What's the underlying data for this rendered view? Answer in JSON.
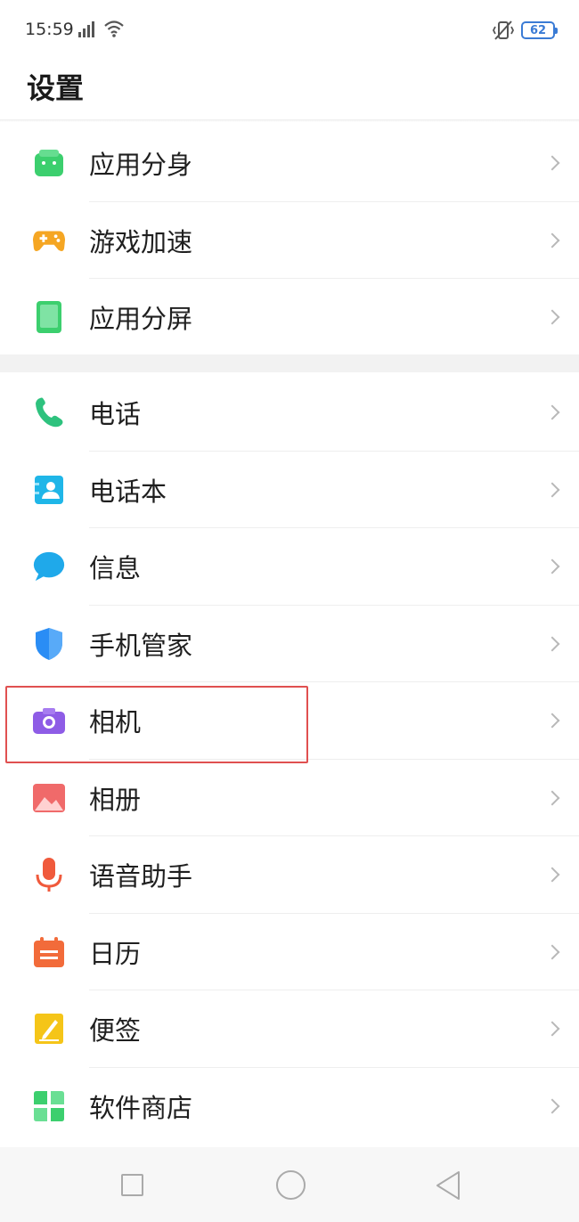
{
  "status_bar": {
    "time": "15:59",
    "battery_level": "62",
    "icons": [
      "signal-icon",
      "wifi-icon",
      "vibrate-icon",
      "battery-icon"
    ]
  },
  "header": {
    "title": "设置"
  },
  "groups": [
    {
      "items": [
        {
          "label": "应用分身",
          "icon": "app-clone-icon",
          "color": "#3ccf6e"
        },
        {
          "label": "游戏加速",
          "icon": "gamepad-icon",
          "color": "#f5a623"
        },
        {
          "label": "应用分屏",
          "icon": "split-screen-icon",
          "color": "#3ccf6e"
        }
      ]
    },
    {
      "items": [
        {
          "label": "电话",
          "icon": "phone-icon",
          "color": "#2ec27e"
        },
        {
          "label": "电话本",
          "icon": "contacts-icon",
          "color": "#1fb6e8"
        },
        {
          "label": "信息",
          "icon": "message-icon",
          "color": "#1fa9ea"
        },
        {
          "label": "手机管家",
          "icon": "shield-icon",
          "color": "#2a8df5"
        },
        {
          "label": "相机",
          "icon": "camera-icon",
          "color": "#8e5ce6"
        },
        {
          "label": "相册",
          "icon": "gallery-icon",
          "color": "#f06a6a"
        },
        {
          "label": "语音助手",
          "icon": "microphone-icon",
          "color": "#f05a3c"
        },
        {
          "label": "日历",
          "icon": "calendar-icon",
          "color": "#f26b3a"
        },
        {
          "label": "便签",
          "icon": "notes-icon",
          "color": "#f5c518"
        },
        {
          "label": "软件商店",
          "icon": "app-store-icon",
          "color": "#3ccf6e"
        }
      ]
    }
  ],
  "nav_bar": {
    "icons": [
      "recent-apps-icon",
      "home-icon",
      "back-icon"
    ]
  }
}
